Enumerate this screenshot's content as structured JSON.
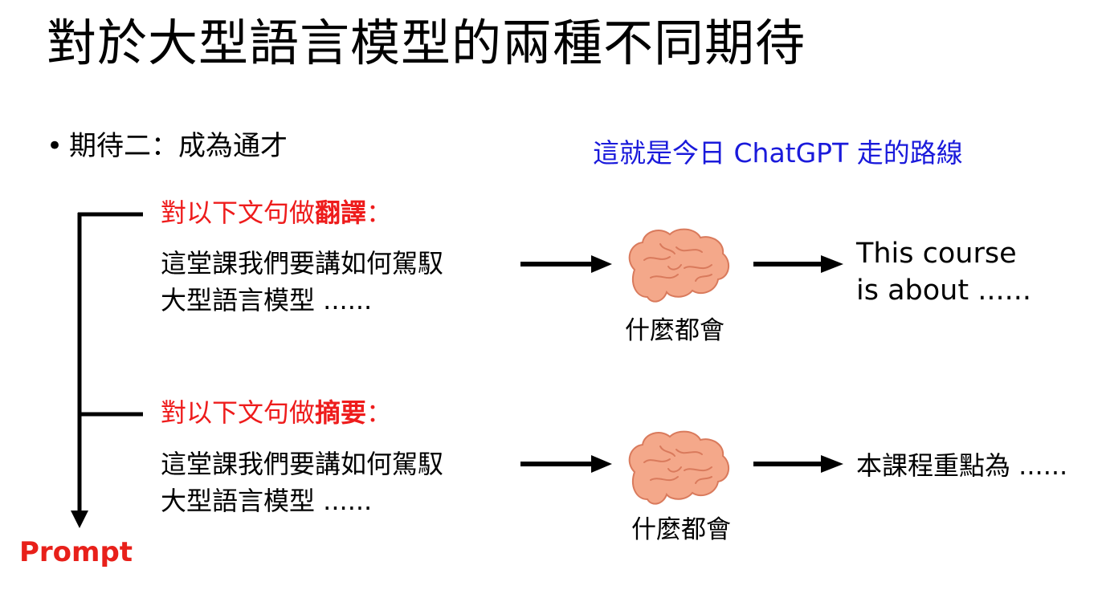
{
  "slide": {
    "title": "對於大型語言模型的兩種不同期待",
    "bullet": "期待二：成為通才",
    "bullet_marker": "•",
    "note": "這就是今日 ChatGPT 走的路線",
    "prompt_label": "Prompt"
  },
  "rows": [
    {
      "instruction_prefix": "對以下文句做",
      "instruction_bold": "翻譯",
      "instruction_suffix": "：",
      "input_line1": "這堂課我們要講如何駕馭",
      "input_line2": "大型語言模型 ......",
      "model_label": "什麼都會",
      "output_line1": "This course",
      "output_line2": "is about ......"
    },
    {
      "instruction_prefix": "對以下文句做",
      "instruction_bold": "摘要",
      "instruction_suffix": "：",
      "input_line1": "這堂課我們要講如何駕馭",
      "input_line2": "大型語言模型 ......",
      "model_label": "什麼都會",
      "output_line1": "本課程重點為 ......"
    }
  ],
  "colors": {
    "text": "#000000",
    "instruction": "#ee1c1c",
    "note": "#1a1adb",
    "prompt": "#e8201a",
    "brain_fill": "#f4a88a",
    "brain_stroke": "#d97a5c"
  },
  "icons": [
    "brain-icon",
    "arrow-right-icon",
    "arrow-down-icon"
  ]
}
